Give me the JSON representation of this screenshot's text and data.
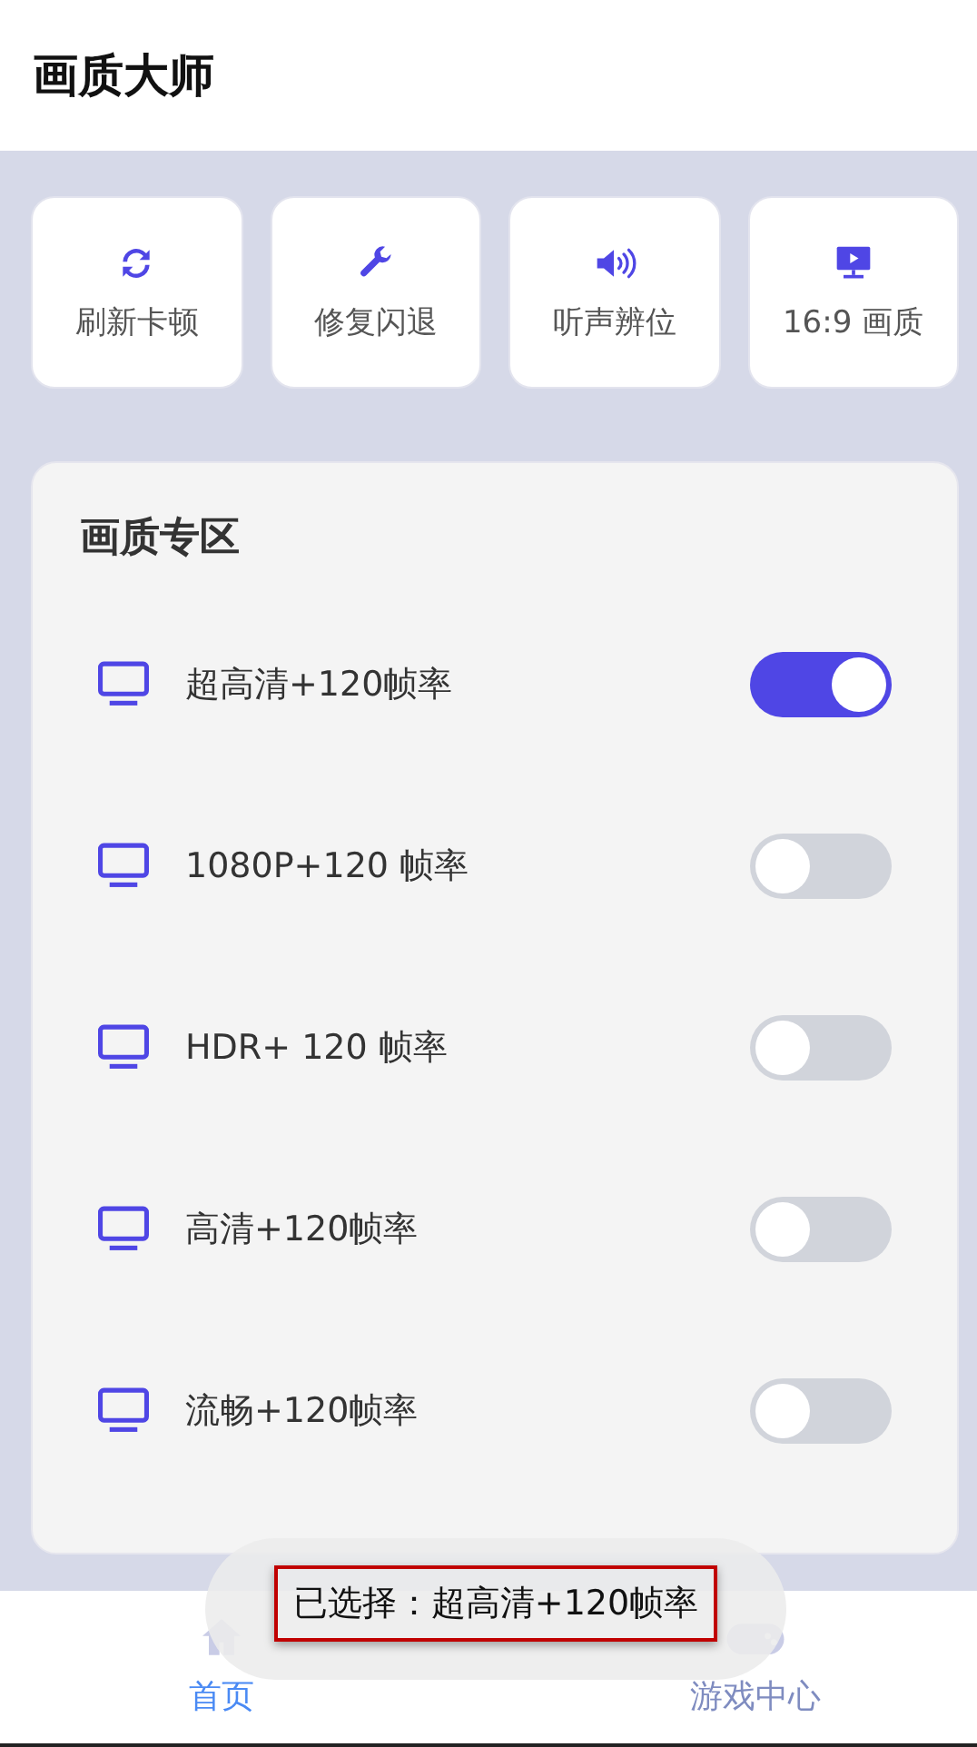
{
  "app_bar": {
    "title": "画质大师"
  },
  "quick_actions": [
    {
      "label": "刷新卡顿"
    },
    {
      "label": "修复闪退"
    },
    {
      "label": "听声辨位"
    },
    {
      "label": "16:9 画质"
    }
  ],
  "quality_panel": {
    "title": "画质专区",
    "options": [
      {
        "label": "超高清+120帧率",
        "on": true
      },
      {
        "label": "1080P+120 帧率",
        "on": false
      },
      {
        "label": "HDR+ 120 帧率",
        "on": false
      },
      {
        "label": "高清+120帧率",
        "on": false
      },
      {
        "label": "流畅+120帧率",
        "on": false
      }
    ]
  },
  "bottom_nav": [
    {
      "label": "首页",
      "selected": true
    },
    {
      "label": "游戏中心",
      "selected": false
    }
  ],
  "toast": {
    "text": "已选择：超高清+120帧率"
  }
}
